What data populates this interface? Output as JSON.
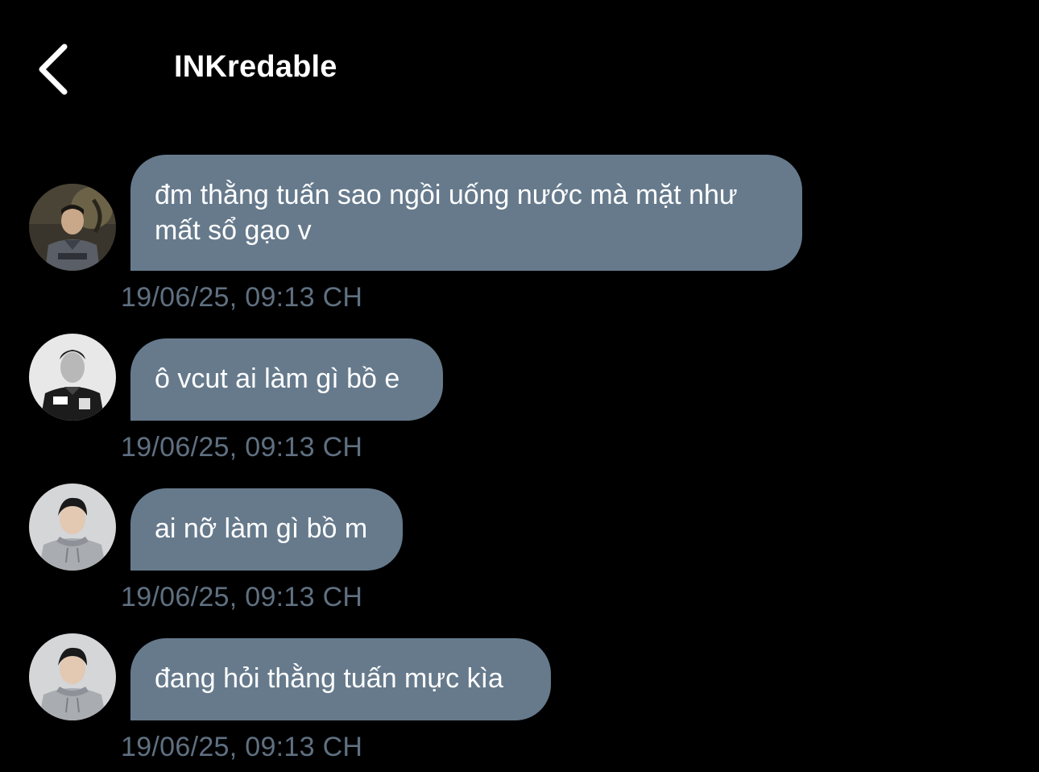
{
  "header": {
    "title": "INKredable",
    "back_icon": "chevron-left-icon"
  },
  "colors": {
    "background": "#000000",
    "bubble": "#667a8c",
    "timestamp": "#5f7081",
    "text": "#ffffff"
  },
  "messages": [
    {
      "text": "đm thằng tuấn sao ngồi uống nước mà mặt như mất sổ gạo v",
      "timestamp": "19/06/25, 09:13 CH",
      "avatar": "avatar-player-jersey"
    },
    {
      "text": "ô vcut ai làm gì bồ e",
      "timestamp": "19/06/25, 09:13 CH",
      "avatar": "avatar-bw-portrait"
    },
    {
      "text": "ai nỡ làm gì bồ m",
      "timestamp": "19/06/25, 09:13 CH",
      "avatar": "avatar-grey-hoodie"
    },
    {
      "text": "đang hỏi thằng tuấn mực kìa",
      "timestamp": "19/06/25, 09:13 CH",
      "avatar": "avatar-grey-hoodie"
    }
  ]
}
